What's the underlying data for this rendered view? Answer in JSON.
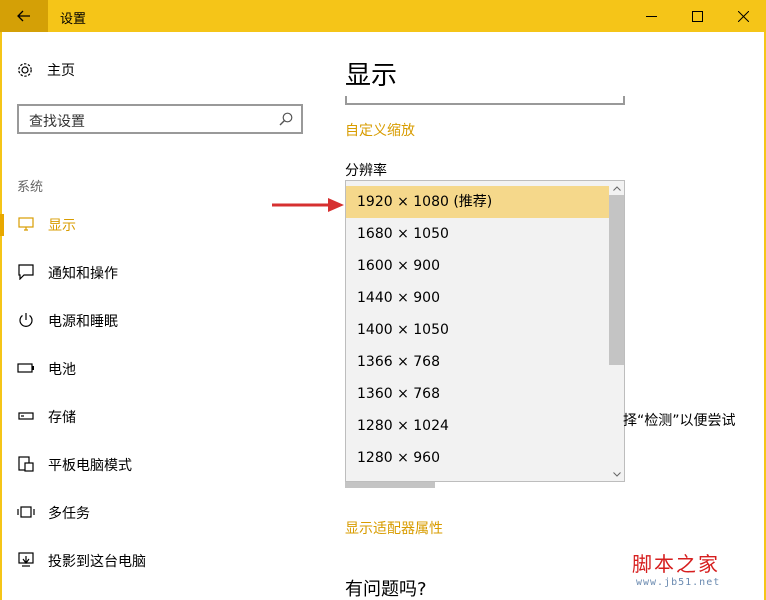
{
  "window": {
    "title": "设置",
    "icons": {
      "back": "back-arrow-icon",
      "minimize": "minimize-icon",
      "maximize": "maximize-icon",
      "close": "close-icon"
    },
    "accent": "#f5c518"
  },
  "sidebar": {
    "home_label": "主页",
    "search_placeholder": "查找设置",
    "section_label": "系统",
    "items": [
      {
        "label": "显示",
        "icon": "monitor-icon",
        "active": true
      },
      {
        "label": "通知和操作",
        "icon": "notification-icon",
        "active": false
      },
      {
        "label": "电源和睡眠",
        "icon": "power-icon",
        "active": false
      },
      {
        "label": "电池",
        "icon": "battery-icon",
        "active": false
      },
      {
        "label": "存储",
        "icon": "storage-icon",
        "active": false
      },
      {
        "label": "平板电脑模式",
        "icon": "tablet-mode-icon",
        "active": false
      },
      {
        "label": "多任务",
        "icon": "multitask-icon",
        "active": false
      },
      {
        "label": "投影到这台电脑",
        "icon": "project-icon",
        "active": false
      }
    ]
  },
  "main": {
    "title": "显示",
    "custom_scaling_link": "自定义缩放",
    "resolution_label": "分辨率",
    "resolutions": [
      "1920 × 1080 (推荐)",
      "1680 × 1050",
      "1600 × 900",
      "1440 × 900",
      "1400 × 1050",
      "1366 × 768",
      "1360 × 768",
      "1280 × 1024",
      "1280 × 960"
    ],
    "selected_index": 0,
    "partial_text": "择“检测”以便尝试",
    "adapter_link": "显示适配器属性",
    "help_title": "有问题吗?"
  },
  "watermark": {
    "main": "脚本之家",
    "sub": "www.jb51.net"
  }
}
